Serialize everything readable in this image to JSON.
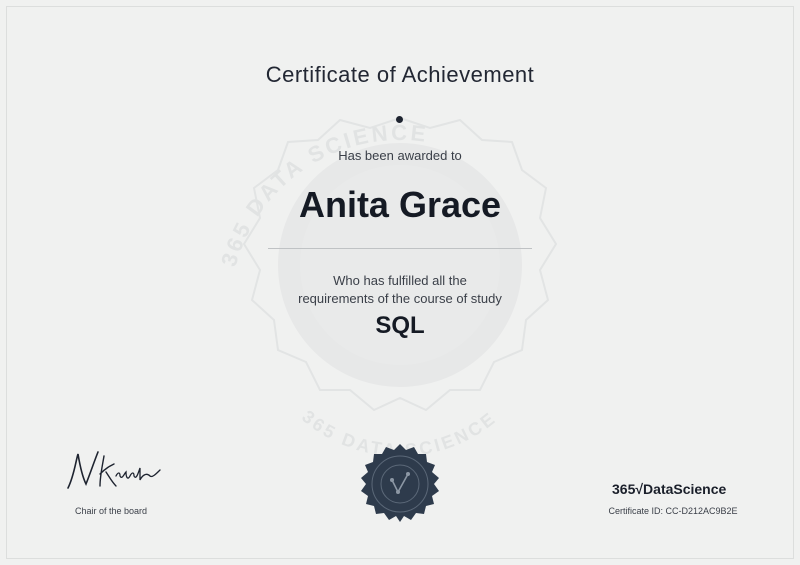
{
  "certificate": {
    "title": "Certificate of Achievement",
    "awarded_text": "Has been awarded to",
    "recipient": "Anita Grace",
    "description_line1": "Who has fulfilled all the",
    "description_line2": "requirements of the course of study",
    "course": "SQL"
  },
  "watermark": {
    "text": "365 DATA SCIENCE"
  },
  "signature": {
    "label": "Chair of the board"
  },
  "brand": {
    "logo_text": "365√DataScience"
  },
  "footer": {
    "certificate_id": "Certificate ID: CC-D212AC9B2E"
  },
  "colors": {
    "background": "#f0f1f0",
    "text": "#1e2430",
    "seal": "#2c3a4a"
  }
}
